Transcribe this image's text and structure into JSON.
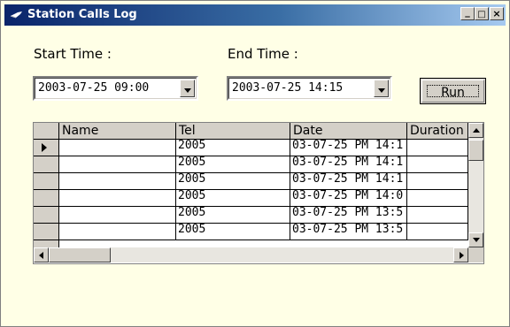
{
  "window": {
    "title": "Station Calls Log",
    "controls": [
      "_",
      "□",
      "×"
    ]
  },
  "form": {
    "start_label": "Start Time :",
    "end_label": "End Time :",
    "start_value": "2003-07-25 09:00",
    "end_value": "2003-07-25 14:15",
    "run_label": "Run"
  },
  "grid": {
    "columns": [
      "Name",
      "Tel",
      "Date",
      "Duration"
    ],
    "rows": [
      {
        "name": "",
        "tel": "2005",
        "date": "03-07-25 PM 14:1",
        "duration": ""
      },
      {
        "name": "",
        "tel": "2005",
        "date": "03-07-25 PM 14:1",
        "duration": ""
      },
      {
        "name": "",
        "tel": "2005",
        "date": "03-07-25 PM 14:1",
        "duration": ""
      },
      {
        "name": "",
        "tel": "2005",
        "date": "03-07-25 PM 14:0",
        "duration": ""
      },
      {
        "name": "",
        "tel": "2005",
        "date": "03-07-25 PM 13:5",
        "duration": ""
      },
      {
        "name": "",
        "tel": "2005",
        "date": "03-07-25 PM 13:5",
        "duration": ""
      }
    ],
    "current_row": 1
  },
  "colors": {
    "title_start": "#0a246a",
    "title_end": "#a6caf0",
    "form_bg": "#ffffe6",
    "button_face": "#d4d0c8"
  }
}
